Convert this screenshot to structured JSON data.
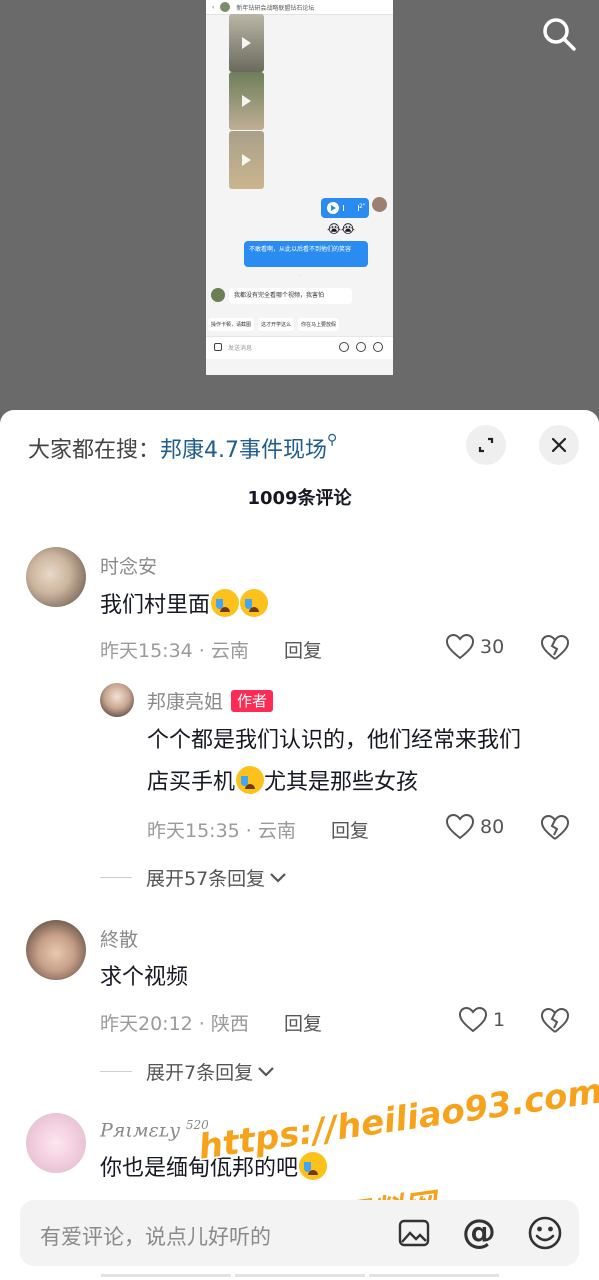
{
  "video": {
    "chat_title": "新年钻研会战略联盟钻石论坛",
    "voice_duration": "2\"",
    "emoji_reply": "😭😭",
    "bubble_text": "不敢看啊，从此以后看不到他们的笑容",
    "other_bubble_text": "我都没有完全看哪个视频，我害怕",
    "quick_replies": [
      "操作卡顿，请截图",
      "这才开学这么",
      "你在马上要放假"
    ],
    "input_placeholder": "发送消息"
  },
  "header": {
    "trending_label": "大家都在搜：",
    "trending_keyword": "邦康4.7事件现场",
    "comment_count": "1009条评论"
  },
  "comments": [
    {
      "username": "时念安",
      "text": "我们村里面",
      "time": "昨天15:34 · 云南",
      "reply_label": "回复",
      "likes": "30",
      "reply": {
        "username": "邦康亮姐",
        "badge": "作者",
        "text_line1": "个个都是我们认识的，他们经常来我们",
        "text_line2_a": "店买手机",
        "text_line2_b": "尤其是那些女孩",
        "time": "昨天15:35 · 云南",
        "reply_label": "回复",
        "likes": "80"
      },
      "expand_label": "展开57条回复"
    },
    {
      "username": "終散",
      "text": "求个视频",
      "time": "昨天20:12 · 陕西",
      "reply_label": "回复",
      "likes": "1",
      "expand_label": "展开7条回复"
    },
    {
      "username": "Pяιмεʟy",
      "username_suffix": "520",
      "text": "你也是缅甸佤邦的吧"
    }
  ],
  "input_bar": {
    "placeholder": "有爱评论，说点儿好听的",
    "at_symbol": "@"
  },
  "watermark": {
    "url": "https://heiliao93.com",
    "site_name": "黑料网"
  }
}
